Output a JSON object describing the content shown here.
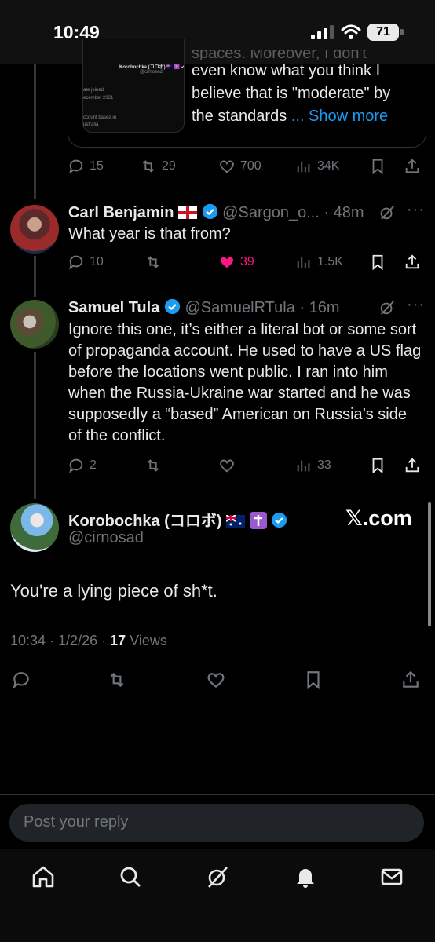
{
  "status_bar": {
    "time": "10:49",
    "battery": "71"
  },
  "quoted_post": {
    "card_name": "Korobochka (コロボ) 🇦🇺 ✝️ ✔",
    "card_handle": "@cirnosad",
    "card_joined": "ate joined",
    "card_joined_date": "ecember 2021",
    "card_account": "ccount based in",
    "card_country": "ustralia",
    "line1": "spaces. Moreover, I don't",
    "line2": "even know what you think I",
    "line3": "believe that is \"moderate\" by",
    "line4": "the standards",
    "show_more": "... Show more"
  },
  "post1_actions": {
    "replies": "15",
    "reposts": "29",
    "likes": "700",
    "views": "34K"
  },
  "reply1": {
    "name": "Carl Benjamin",
    "handle": "@Sargon_o...",
    "time": "· 48m",
    "text": "What year is that from?",
    "replies": "10",
    "likes": "39",
    "views": "1.5K",
    "liked_color": "#f91880"
  },
  "reply2": {
    "name": "Samuel Tula",
    "handle": "@SamuelRTula",
    "time": "· 16m",
    "text": "Ignore this one, it’s either a literal bot or some sort of propaganda account. He used to have a US flag before the locations went public. I ran into him when the Russia-Ukraine war started and he was supposedly a “based” American on Russia’s side of the conflict.",
    "replies": "2",
    "views": "33"
  },
  "main_post": {
    "name": "Korobochka (コロボ)",
    "handle": "@cirnosad",
    "text": "You're a lying piece of sh*t.",
    "time": "10:34",
    "date": "1/2/26",
    "views_count": "17",
    "views_label": "Views"
  },
  "watermark": "𝕏.com",
  "reply_box": {
    "placeholder": "Post your reply"
  },
  "colors": {
    "accent": "#1d9bf0",
    "muted": "#71767b",
    "like": "#f91880",
    "background": "#000000"
  },
  "icons": [
    "home-icon",
    "search-icon",
    "grok-icon",
    "notifications-icon",
    "messages-icon"
  ]
}
